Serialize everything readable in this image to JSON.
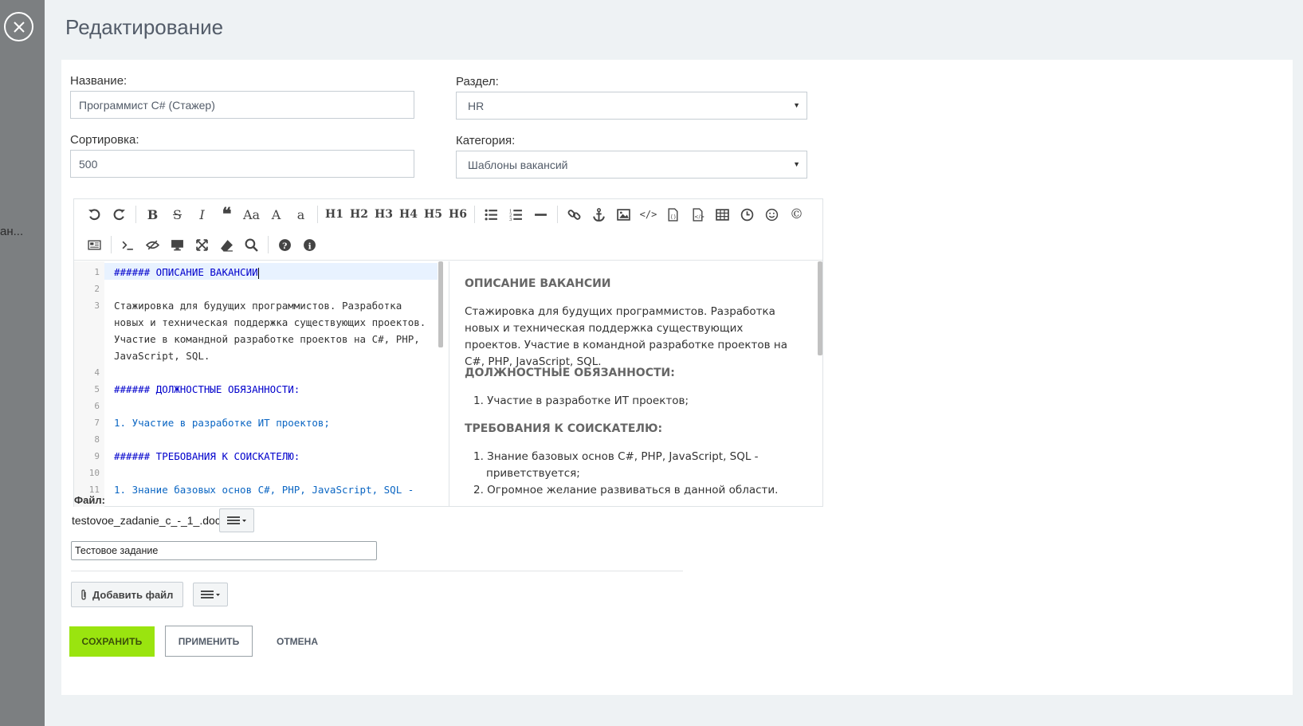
{
  "backdrop": {
    "text": "ан..."
  },
  "title": "Редактирование",
  "form": {
    "name_label": "Название:",
    "name_value": "Программист С# (Стажер)",
    "section_label": "Раздел:",
    "section_value": "HR",
    "sort_label": "Сортировка:",
    "sort_value": "500",
    "category_label": "Категория:",
    "category_value": "Шаблоны вакансий"
  },
  "toolbar": {
    "row1": [
      "undo-icon",
      "redo-icon",
      "|",
      "bold-icon",
      "strikethrough-icon",
      "italic-icon",
      "quote-icon",
      "case-icon",
      "uppercase-icon",
      "lowercase-icon",
      "|",
      "h1",
      "h2",
      "h3",
      "h4",
      "h5",
      "h6",
      "|",
      "unordered-list-icon",
      "ordered-list-icon",
      "horizontal-rule-icon",
      "|",
      "link-icon",
      "anchor-icon",
      "image-icon",
      "code-icon",
      "code-block-icon",
      "code-file-icon",
      "table-icon",
      "datetime-icon",
      "emoji-icon",
      "copyright-icon"
    ],
    "row2": [
      "preview-page-icon",
      "|",
      "html-code-icon",
      "hide-preview-icon",
      "desktop-icon",
      "fullscreen-icon",
      "clear-icon",
      "search-icon",
      "|",
      "help-icon",
      "info-icon"
    ],
    "labels": {
      "h1": "H1",
      "h2": "H2",
      "h3": "H3",
      "h4": "H4",
      "h5": "H5",
      "h6": "H6",
      "bold": "B",
      "italic": "I",
      "case": "Aa",
      "upper": "A",
      "lower": "a",
      "strike": "S"
    }
  },
  "code_lines": [
    {
      "n": "1",
      "text": "###### ОПИСАНИЕ ВАКАНСИИ",
      "kind": "h"
    },
    {
      "n": "2",
      "text": "",
      "kind": ""
    },
    {
      "n": "3",
      "text": "Стажировка для будущих программистов. Разработка",
      "kind": ""
    },
    {
      "n": "",
      "text": "новых и техническая поддержка существующих проектов.",
      "kind": ""
    },
    {
      "n": "",
      "text": "Участие в командной разработке проектов на C#, PHP,",
      "kind": ""
    },
    {
      "n": "",
      "text": "JavaScript, SQL.",
      "kind": ""
    },
    {
      "n": "4",
      "text": "",
      "kind": ""
    },
    {
      "n": "5",
      "text": "###### ДОЛЖНОСТНЫЕ ОБЯЗАННОСТИ:",
      "kind": "h"
    },
    {
      "n": "6",
      "text": "",
      "kind": ""
    },
    {
      "n": "7",
      "text": "1. Участие в разработке ИТ проектов;",
      "kind": "li"
    },
    {
      "n": "8",
      "text": "",
      "kind": ""
    },
    {
      "n": "9",
      "text": "###### ТРЕБОВАНИЯ К СОИСКАТЕЛЮ:",
      "kind": "h"
    },
    {
      "n": "10",
      "text": "",
      "kind": ""
    },
    {
      "n": "11",
      "text": "1. Знание базовых основ C#, PHP, JavaScript, SQL -",
      "kind": "li"
    }
  ],
  "preview": {
    "h1": "ОПИСАНИЕ ВАКАНСИИ",
    "p1": "Стажировка для будущих программистов. Разработка новых и техническая поддержка существующих проектов. Участие в командной разработке проектов на C#, PHP, JavaScript, SQL.",
    "h2": "ДОЛЖНОСТНЫЕ ОБЯЗАННОСТИ:",
    "li1": "1. Участие в разработке ИТ проектов;",
    "h3": "ТРЕБОВАНИЯ К СОИСКАТЕЛЮ:",
    "li2a": "1. Знание базовых основ C#, PHP, JavaScript, SQL -",
    "li2b": "приветствуется;",
    "li3": "2. Огромное желание развиваться в данной области."
  },
  "file": {
    "label": "Файл:",
    "name": "testovoe_zadanie_c_-_1_.doc",
    "description": "Тестовое задание",
    "add_label": "Добавить файл"
  },
  "buttons": {
    "save": "СОХРАНИТЬ",
    "apply": "ПРИМЕНИТЬ",
    "cancel": "ОТМЕНА"
  },
  "colors": {
    "save_bg": "#9ae40f",
    "heading_code": "#0000cc",
    "list_code": "#0b66c3",
    "panel_bg": "#eef2f4"
  }
}
